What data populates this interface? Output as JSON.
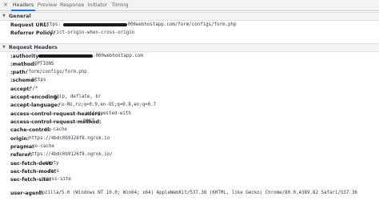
{
  "tabs": {
    "close": "×",
    "headers": "Headers",
    "preview": "Preview",
    "response": "Response",
    "initiator": "Initiator",
    "timing": "Timing"
  },
  "general": {
    "title": "General",
    "toggle": "▼",
    "rows": [
      {
        "key": "Request URL:",
        "value_prefix": "https:",
        "value_suffix": "000webhostapp.com/form/configs/form.php"
      },
      {
        "key": "Referrer Policy:",
        "value": "strict-origin-when-cross-origin"
      }
    ]
  },
  "request_headers": {
    "title": "Request Headers",
    "toggle": "▼",
    "rows": [
      {
        "key": ":authority:",
        "value_suffix": ".000webhostapp.com"
      },
      {
        "key": ":method:",
        "value": "OPTIONS"
      },
      {
        "key": ":path:",
        "value": "/form/configs/form.php"
      },
      {
        "key": ":scheme:",
        "value": "https"
      },
      {
        "key": "accept:",
        "value": "*/*"
      },
      {
        "key": "accept-encoding:",
        "value": "gzip, deflate, br"
      },
      {
        "key": "accept-language:",
        "value": "ru-RU,ru;q=0.9,en-US;q=0.8,en;q=0.7"
      },
      {
        "key": "access-control-request-headers:",
        "value": "x-requested-with"
      },
      {
        "key": "access-control-request-method:",
        "value": "POST"
      },
      {
        "key": "cache-control:",
        "value": "no-cache"
      },
      {
        "key": "origin:",
        "value": "https://4bdc0b9126f8.ngrok.io"
      },
      {
        "key": "pragma:",
        "value": "no-cache"
      },
      {
        "key": "referer:",
        "value": "https://4bdc0b9126f8.ngrok.io/"
      },
      {
        "key": "sec-fetch-dest:",
        "value": "empty"
      },
      {
        "key": "sec-fetch-mode:",
        "value": "cors"
      },
      {
        "key": "sec-fetch-site:",
        "value": "cross-site"
      },
      {
        "key": "user-agent:",
        "value": "Mozilla/5.0 (Windows NT 10.0; Win64; x64) AppleWebKit/537.36 (KHTML, like Gecko) Chrome/80.0.4389.82 Safari/537.36"
      }
    ]
  }
}
